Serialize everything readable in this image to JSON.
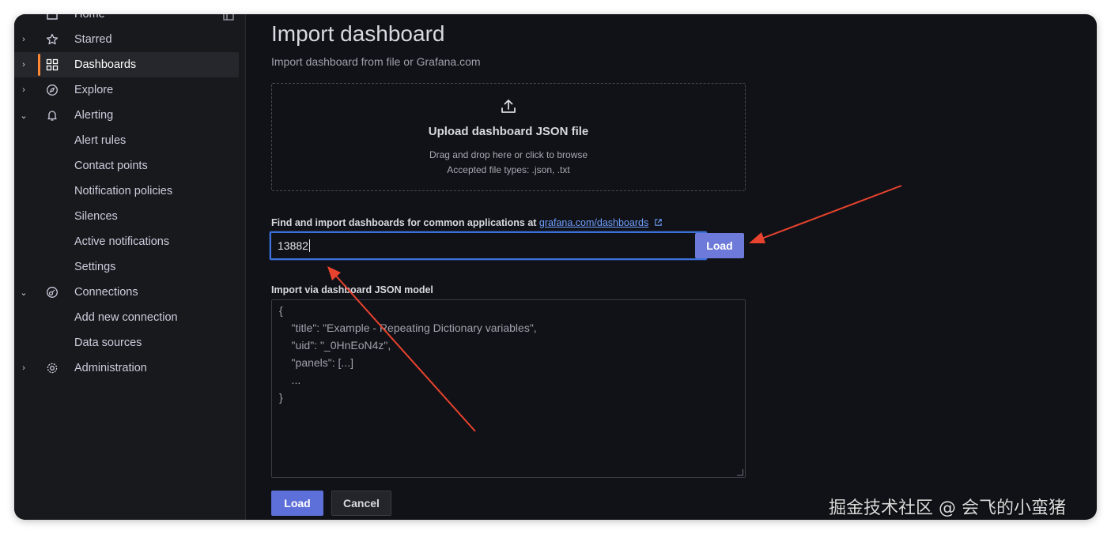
{
  "sidebar": {
    "items": [
      {
        "label": "Home",
        "icon": "home-icon",
        "chevron": ""
      },
      {
        "label": "Starred",
        "icon": "star-icon",
        "chevron": "›"
      },
      {
        "label": "Dashboards",
        "icon": "grid-icon",
        "chevron": "›",
        "active": true
      },
      {
        "label": "Explore",
        "icon": "compass-icon",
        "chevron": "›"
      },
      {
        "label": "Alerting",
        "icon": "bell-icon",
        "chevron": "⌄"
      },
      {
        "label": "Connections",
        "icon": "connections-icon",
        "chevron": "⌄"
      },
      {
        "label": "Administration",
        "icon": "cog-icon",
        "chevron": "›"
      }
    ],
    "alerting_children": [
      "Alert rules",
      "Contact points",
      "Notification policies",
      "Silences",
      "Active notifications",
      "Settings"
    ],
    "connections_children": [
      "Add new connection",
      "Data sources"
    ]
  },
  "main": {
    "title": "Import dashboard",
    "subtitle": "Import dashboard from file or Grafana.com",
    "upload": {
      "title": "Upload dashboard JSON file",
      "hint1": "Drag and drop here or click to browse",
      "hint2": "Accepted file types: .json, .txt"
    },
    "find": {
      "label": "Find and import dashboards for common applications at ",
      "link": "grafana.com/dashboards",
      "value": "13882",
      "load_label": "Load"
    },
    "json_model": {
      "label": "Import via dashboard JSON model",
      "lines": [
        "{",
        "    \"title\": \"Example - Repeating Dictionary variables\",",
        "    \"uid\": \"_0HnEoN4z\",",
        "    \"panels\": [...]",
        "    ...",
        "}"
      ]
    },
    "buttons": {
      "load": "Load",
      "cancel": "Cancel"
    }
  },
  "watermark": "掘金技术社区 @ 会飞的小蛮猪",
  "colors": {
    "accent": "#ff8833",
    "primary": "#5d6fd8",
    "link": "#6e9fff",
    "annotation": "#e8432e"
  }
}
